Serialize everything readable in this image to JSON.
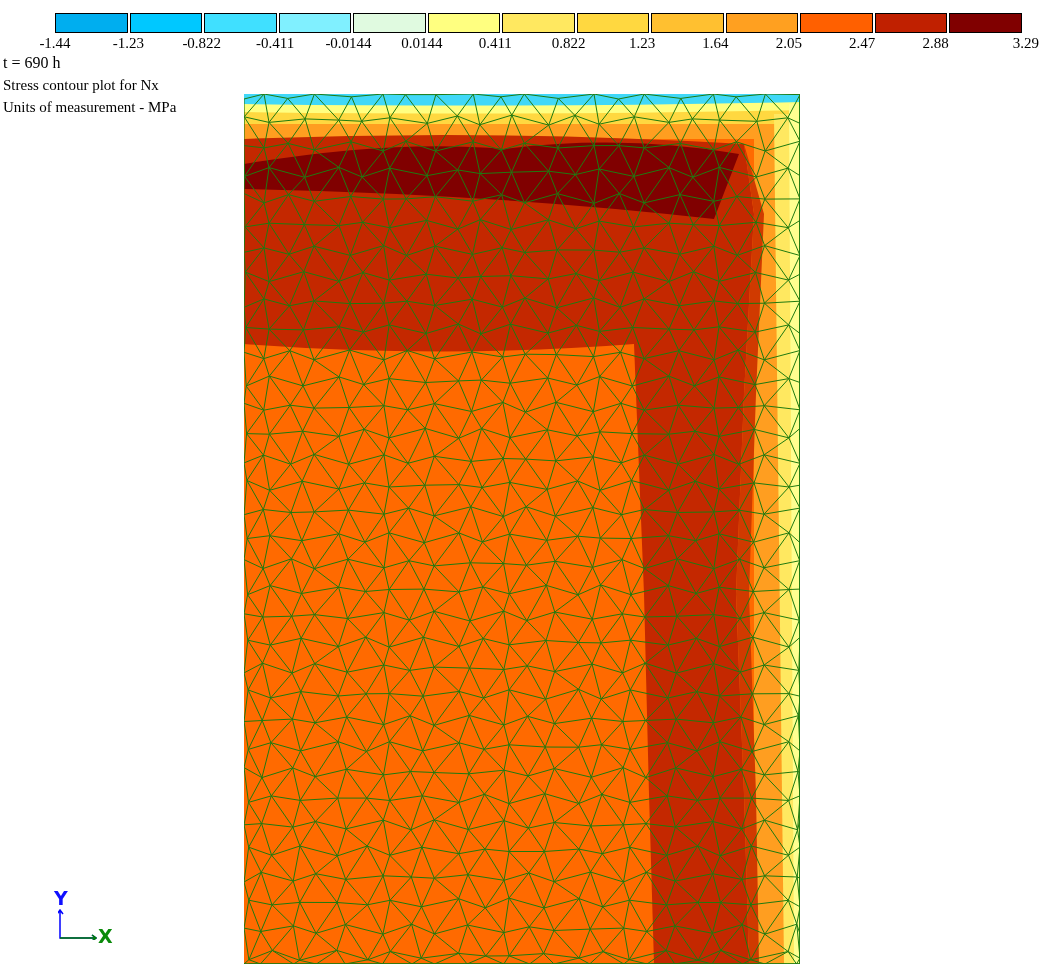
{
  "legend": {
    "swatches": [
      {
        "color": "#00aeef"
      },
      {
        "color": "#00c8ff"
      },
      {
        "color": "#40e0ff"
      },
      {
        "color": "#80f0ff"
      },
      {
        "color": "#e0fae0"
      },
      {
        "color": "#ffff80"
      },
      {
        "color": "#ffe860"
      },
      {
        "color": "#ffd840"
      },
      {
        "color": "#ffc030"
      },
      {
        "color": "#ffa020"
      },
      {
        "color": "#ff6000"
      },
      {
        "color": "#c02000"
      },
      {
        "color": "#800000"
      }
    ],
    "labels": [
      "-1.44",
      "-1.23",
      "-0.822",
      "-0.411",
      "-0.0144",
      "0.0144",
      "0.411",
      "0.822",
      "1.23",
      "1.64",
      "2.05",
      "2.47",
      "2.88",
      "3.29"
    ]
  },
  "info": {
    "time": "t = 690 h",
    "title": "Stress contour plot for Nx",
    "units": "Units of measurement - MPa"
  },
  "axes": {
    "y_label": "Y",
    "x_label": "X"
  }
}
